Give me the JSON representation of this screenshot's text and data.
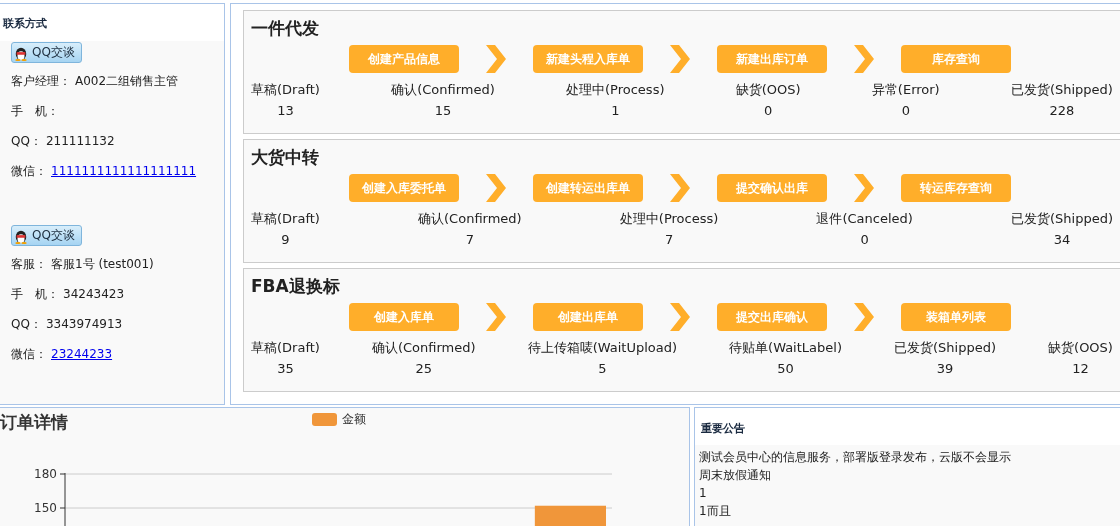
{
  "contacts": {
    "title": "联系方式",
    "groups": [
      {
        "qq_button": "QQ交谈",
        "fields": [
          {
            "label": "客户经理：",
            "value": "A002二组销售主管",
            "kind": "text"
          },
          {
            "label": "手　机：",
            "kind": "text"
          },
          {
            "label": "QQ：",
            "value": "211111132",
            "kind": "text"
          },
          {
            "label": "微信：",
            "value": "1111111111111111111",
            "kind": "link"
          }
        ]
      },
      {
        "qq_button": "QQ交谈",
        "fields": [
          {
            "label": "客服：",
            "value": "客服1号 (test001)",
            "kind": "text"
          },
          {
            "label": "手　机：",
            "value": "34243423",
            "kind": "text"
          },
          {
            "label": "QQ：",
            "value": "3343974913",
            "kind": "text"
          },
          {
            "label": "微信：",
            "value": "23244233",
            "kind": "link"
          }
        ]
      }
    ]
  },
  "workflows": [
    {
      "title": "一件代发",
      "steps": [
        "创建产品信息",
        "新建头程入库单",
        "新建出库订单",
        "库存查询"
      ],
      "stats": [
        {
          "label": "草稿(Draft)",
          "count": "13"
        },
        {
          "label": "确认(Confirmed)",
          "count": "15"
        },
        {
          "label": "处理中(Process)",
          "count": "1"
        },
        {
          "label": "缺货(OOS)",
          "count": "0"
        },
        {
          "label": "异常(Error)",
          "count": "0"
        },
        {
          "label": "已发货(Shipped)",
          "count": "228"
        }
      ]
    },
    {
      "title": "大货中转",
      "steps": [
        "创建入库委托单",
        "创建转运出库单",
        "提交确认出库",
        "转运库存查询"
      ],
      "stats": [
        {
          "label": "草稿(Draft)",
          "count": "9"
        },
        {
          "label": "确认(Confirmed)",
          "count": "7"
        },
        {
          "label": "处理中(Process)",
          "count": "7"
        },
        {
          "label": "退件(Canceled)",
          "count": "0"
        },
        {
          "label": "已发货(Shipped)",
          "count": "34"
        }
      ]
    },
    {
      "title": "FBA退换标",
      "steps": [
        "创建入库单",
        "创建出库单",
        "提交出库确认",
        "装箱单列表"
      ],
      "stats": [
        {
          "label": "草稿(Draft)",
          "count": "35"
        },
        {
          "label": "确认(Confirmed)",
          "count": "25"
        },
        {
          "label": "待上传箱唛(WaitUpload)",
          "count": "5"
        },
        {
          "label": "待贴单(WaitLabel)",
          "count": "50"
        },
        {
          "label": "已发货(Shipped)",
          "count": "39"
        },
        {
          "label": "缺货(OOS)",
          "count": "12"
        }
      ]
    }
  ],
  "order_chart": {
    "title": "订单详情",
    "chart_data": {
      "type": "bar",
      "ylim": [
        0,
        180
      ],
      "yticks": [
        150,
        180
      ],
      "series": [
        {
          "name": "金额",
          "color": "#f0963a",
          "values": [
            null,
            null,
            null,
            null,
            null,
            152
          ]
        }
      ]
    }
  },
  "notice": {
    "title": "重要公告",
    "lines": [
      "测试会员中心的信息服务，部署版登录发布，云版不会显示",
      "周末放假通知",
      "1",
      "1而且"
    ]
  }
}
